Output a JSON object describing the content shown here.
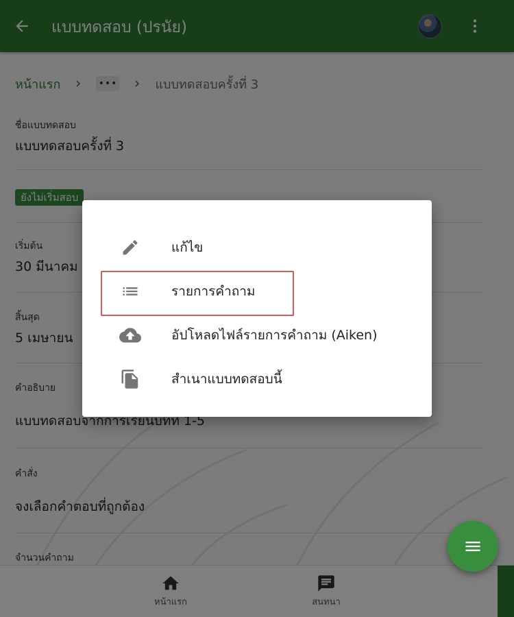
{
  "appbar": {
    "title": "แบบทดสอบ (ปรนัย)",
    "back_icon": "arrow-back-icon",
    "more_icon": "more-vert-icon"
  },
  "breadcrumb": {
    "home": "หน้าแรก",
    "ellipsis": "•••",
    "current": "แบบทดสอบครั้งที่ 3"
  },
  "fields": {
    "name_label": "ชื่อแบบทดสอบ",
    "name_value": "แบบทดสอบครั้งที่ 3",
    "status": "ยังไม่เริ่มสอบ",
    "start_label": "เริ่มต้น",
    "start_value": "30 มีนาคม",
    "end_label": "สิ้นสุด",
    "end_value": "5 เมษายน",
    "desc_label": "คำอธิบาย",
    "desc_value": "แบบทดสอบจากการเรียนบทที่ 1-5",
    "instr_label": "คำสั่ง",
    "instr_value": "จงเลือกคำตอบที่ถูกต้อง",
    "count_label": "จำนวนคำถาม"
  },
  "menu": {
    "items": [
      {
        "label": "แก้ไข",
        "icon": "pencil-icon"
      },
      {
        "label": "รายการคำถาม",
        "icon": "list-icon"
      },
      {
        "label": "อัปโหลดไฟล์รายการคำถาม (Aiken)",
        "icon": "cloud-upload-icon"
      },
      {
        "label": "สำเนาแบบทดสอบนี้",
        "icon": "copy-file-icon"
      }
    ]
  },
  "bottomnav": {
    "home_label": "หน้าแรก",
    "chat_label": "สนทนา"
  },
  "colors": {
    "primary": "#2e7d32",
    "fab": "#388e3c",
    "highlight": "#e05555"
  }
}
